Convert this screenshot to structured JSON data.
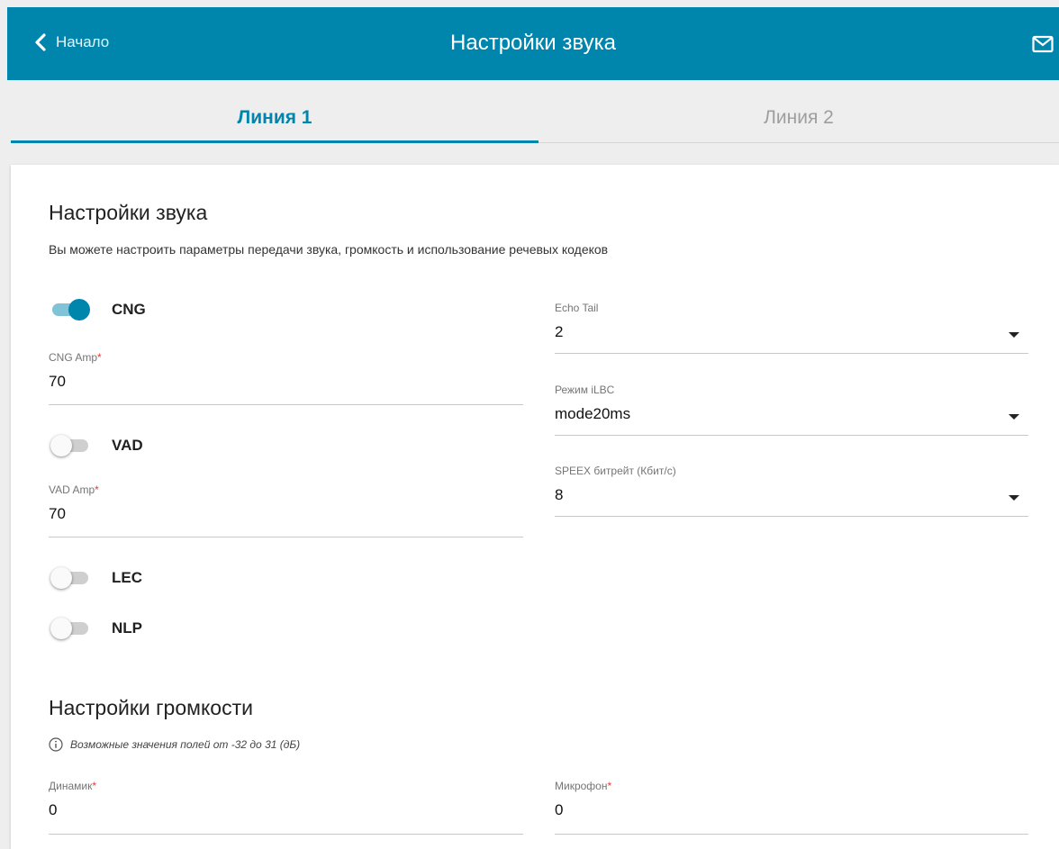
{
  "header": {
    "back_label": "Начало",
    "title": "Настройки звука",
    "accent_color": "#0085ad"
  },
  "tabs": [
    {
      "label": "Линия 1",
      "active": true
    },
    {
      "label": "Линия 2",
      "active": false
    }
  ],
  "sound": {
    "title": "Настройки звука",
    "description": "Вы можете настроить параметры передачи звука, громкость и использование речевых кодеков",
    "toggles": {
      "cng": {
        "label": "CNG",
        "on": true
      },
      "vad": {
        "label": "VAD",
        "on": false
      },
      "lec": {
        "label": "LEC",
        "on": false
      },
      "nlp": {
        "label": "NLP",
        "on": false
      }
    },
    "fields": {
      "cng_amp": {
        "label": "CNG Amp",
        "required_mark": "*",
        "value": "70"
      },
      "vad_amp": {
        "label": "VAD Amp",
        "required_mark": "*",
        "value": "70"
      },
      "echo_tail": {
        "label": "Echo Tail",
        "value": "2"
      },
      "ilbc_mode": {
        "label": "Режим iLBC",
        "value": "mode20ms"
      },
      "speex_bitrate": {
        "label": "SPEEX битрейт (Кбит/с)",
        "value": "8"
      }
    }
  },
  "volume": {
    "title": "Настройки громкости",
    "hint": "Возможные значения полей от -32 до 31 (дБ)",
    "speaker": {
      "label": "Динамик",
      "required_mark": "*",
      "value": "0"
    },
    "microphone": {
      "label": "Микрофон",
      "required_mark": "*",
      "value": "0"
    }
  }
}
